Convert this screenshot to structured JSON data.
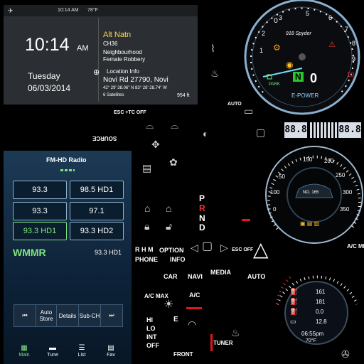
{
  "nav": {
    "time_small": "10:14 AM",
    "temp": "78°F",
    "time_big": "10:14",
    "ampm": "AM",
    "day": "Tuesday",
    "date": "06/03/2014",
    "station": "Alt Natn",
    "channel": "CH36",
    "song_line1": "Neighbourhood",
    "song_line2": "Female Robbery",
    "location_title": "Location Info",
    "road": "Novi Rd 27790, Novi",
    "coords": "42° 29' 38.06\" N    83° 28' 28.74\" W",
    "satellites": "6 Satellites",
    "altitude": "954 ft"
  },
  "radio": {
    "title": "FM-HD Radio",
    "presets": [
      "93.3",
      "98.5 HD1",
      "93.3",
      "97.1",
      "93.3 HD1",
      "93.3 HD2"
    ],
    "station": "WMMR",
    "frequency": "93.3 HD1",
    "controls": {
      "auto_store": "Auto Store",
      "details": "Details",
      "sub_ch": "Sub-CH"
    },
    "tabs": [
      "Main",
      "Tune",
      "List",
      "Fav"
    ]
  },
  "tach": {
    "brand": "918 Spyder",
    "gear": "N",
    "speed": "0",
    "mode": "E-POWER",
    "park": "PARK",
    "ticks": [
      "0",
      "1",
      "2",
      "3",
      "4",
      "5",
      "6",
      "7",
      "8",
      "9",
      "10"
    ]
  },
  "speedo": {
    "ticks": [
      "0",
      "50",
      "100",
      "150",
      "200",
      "250",
      "300",
      "350"
    ],
    "odo": "NO. 165"
  },
  "digital_display": {
    "left": "88.8",
    "right": "88.8"
  },
  "trip": {
    "row1": "161",
    "row2": "181",
    "row3": "0.0",
    "row4": "12.8",
    "time": "06:55pm",
    "temp": "70°F"
  },
  "labels": {
    "source": "SOURCE",
    "esc_tc": "ESC +TC OFF",
    "auto_top": "AUTO",
    "prnd": [
      "P",
      "R",
      "N",
      "D"
    ],
    "rhm": "R H M",
    "phone": "PHONE",
    "option": "OPTION",
    "info": "INFO",
    "esc_off": "ESC OFF",
    "ac_menu": "A/C MENU",
    "car": "CAR",
    "navi": "NAVI",
    "media": "MEDIA",
    "auto": "AUTO",
    "ac_max": "A/C MAX",
    "ac": "A/C",
    "hi": "HI",
    "lo": "LO",
    "int": "INT",
    "off": "OFF",
    "e": "E",
    "front": "FRONT",
    "tuner": "TUNER"
  },
  "colors": {
    "accent_blue": "#7fc3ff",
    "green": "#7fe57f",
    "red": "#e3141c"
  }
}
